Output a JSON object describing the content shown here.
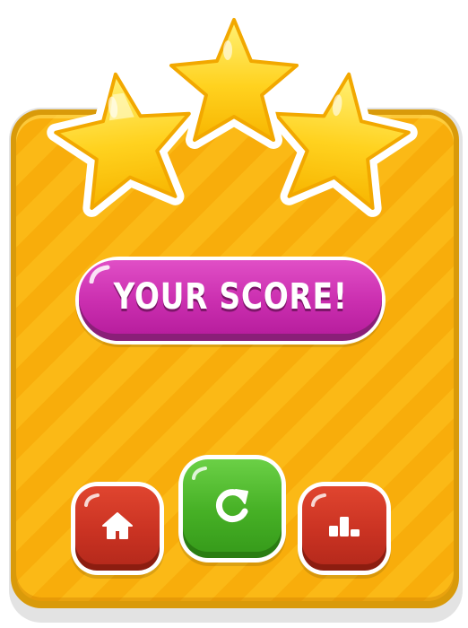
{
  "screen": {
    "title": "YOUR SCORE!",
    "stars_earned": 3,
    "stars_total": 3
  },
  "buttons": {
    "home": {
      "icon": "home-icon"
    },
    "replay": {
      "icon": "restart-icon"
    },
    "leaderboard": {
      "icon": "podium-icon"
    }
  },
  "colors": {
    "panel": "#fbb916",
    "panel_stripe": "#f8ad0b",
    "star": "#ffd21f",
    "title_pill": "#cb2fb0",
    "button_red": "#c93222",
    "button_green": "#47b126"
  }
}
